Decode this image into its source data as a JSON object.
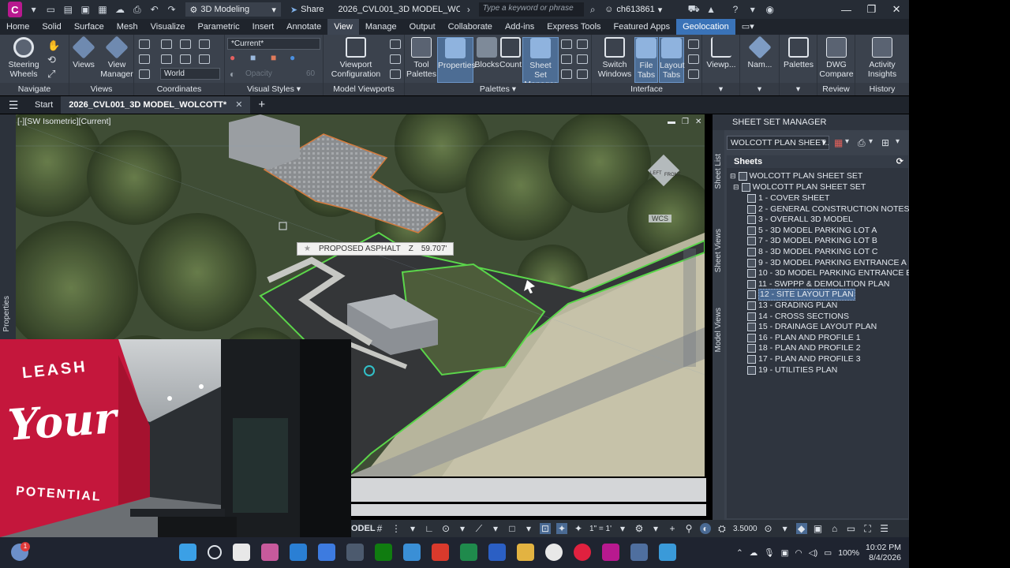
{
  "window": {
    "app_icon_letter": "C",
    "workspace": "3D Modeling",
    "share_label": "Share",
    "doc_title": "2026_CVL001_3D MODEL_WOLCOTT.d...",
    "search_placeholder": "Type a keyword or phrase",
    "user": "ch613861"
  },
  "menu_tabs": [
    "Home",
    "Solid",
    "Surface",
    "Mesh",
    "Visualize",
    "Parametric",
    "Insert",
    "Annotate",
    "View",
    "Manage",
    "Output",
    "Collaborate",
    "Add-ins",
    "Express Tools",
    "Featured Apps",
    "Geolocation"
  ],
  "active_menu_tab": "View",
  "ribbon": {
    "navigate": {
      "steering": "Steering\nWheels",
      "label": "Navigate"
    },
    "views": {
      "views": "Views",
      "view_manager": "View\nManager",
      "label": "Views"
    },
    "coordinates": {
      "world": "World",
      "label": "Coordinates"
    },
    "visual_styles": {
      "current": "*Current*",
      "opacity": "Opacity",
      "opacity_value": "60",
      "label": "Visual Styles"
    },
    "model_viewports": {
      "viewport_config": "Viewport\nConfiguration",
      "label": "Model Viewports"
    },
    "palettes": {
      "tool_palettes": "Tool\nPalettes",
      "properties": "Properties",
      "blocks": "Blocks",
      "count": "Count",
      "ssm": "Sheet Set\nManager",
      "label": "Palettes"
    },
    "interface": {
      "switch_windows": "Switch\nWindows",
      "file_tabs": "File\nTabs",
      "layout_tabs": "Layout\nTabs",
      "label": "Interface"
    },
    "viewpoint": "Viewp...",
    "named": "Nam...",
    "palettes2": "Palettes",
    "review": {
      "dwg_compare": "DWG\nCompare",
      "label": "Review"
    },
    "history": {
      "activity_insights": "Activity\nInsights",
      "label": "History"
    }
  },
  "doc_tabs": {
    "start": "Start",
    "active": "2026_CVL001_3D MODEL_WOLCOTT*"
  },
  "viewport": {
    "view_label": "[-][SW Isometric][Current]",
    "tooltip_label": "PROPOSED ASPHALT",
    "tooltip_axis": "Z",
    "tooltip_value": "59.707'",
    "wcs": "WCS",
    "cube_left": "LEFT",
    "cube_front": "FRONT",
    "properties_tab": "Properties"
  },
  "status": {
    "model": "ODEL",
    "scale": "1\" = 1'",
    "value": "3.5000"
  },
  "ssm": {
    "title": "SHEET SET MANAGER",
    "combo": "WOLCOTT PLAN SHEET...",
    "sheets_header": "Sheets",
    "root": "WOLCOTT PLAN SHEET SET",
    "subset": "WOLCOTT PLAN SHEET SET",
    "side_tabs": [
      "Sheet List",
      "Sheet Views",
      "Model Views"
    ],
    "sheets": [
      "1 - COVER SHEET",
      "2 - GENERAL CONSTRUCTION NOTES",
      "3 - OVERALL 3D MODEL",
      "5 - 3D MODEL PARKING LOT A",
      "7 - 3D MODEL PARKING LOT B",
      "8 - 3D MODEL PARKING LOT C",
      "9 - 3D MODEL PARKING ENTRANCE A",
      "10 - 3D MODEL PARKING ENTRANCE B",
      "11 - SWPPP & DEMOLITION PLAN",
      "12 - SITE LAYOUT PLAN",
      "13 - GRADING PLAN",
      "14 - CROSS SECTIONS",
      "15 - DRAINAGE LAYOUT PLAN",
      "16 - PLAN AND PROFILE 1",
      "18 - PLAN AND PROFILE 2",
      "17 - PLAN AND PROFILE 3",
      "19 - UTILITIES PLAN"
    ],
    "selected_index": 9
  },
  "webcam": {
    "wall_text_top": "LEASH",
    "wall_text_mid": "Your",
    "wall_text_bottom": "POTENTIAL"
  },
  "taskbar": {
    "notification_badge": "1",
    "battery": "100%",
    "time": "10:02 PM",
    "date": "8/4/2026"
  },
  "colors": {
    "accent": "#3a73b8",
    "magenta": "#b8198f",
    "ribbon": "#3b424d"
  }
}
